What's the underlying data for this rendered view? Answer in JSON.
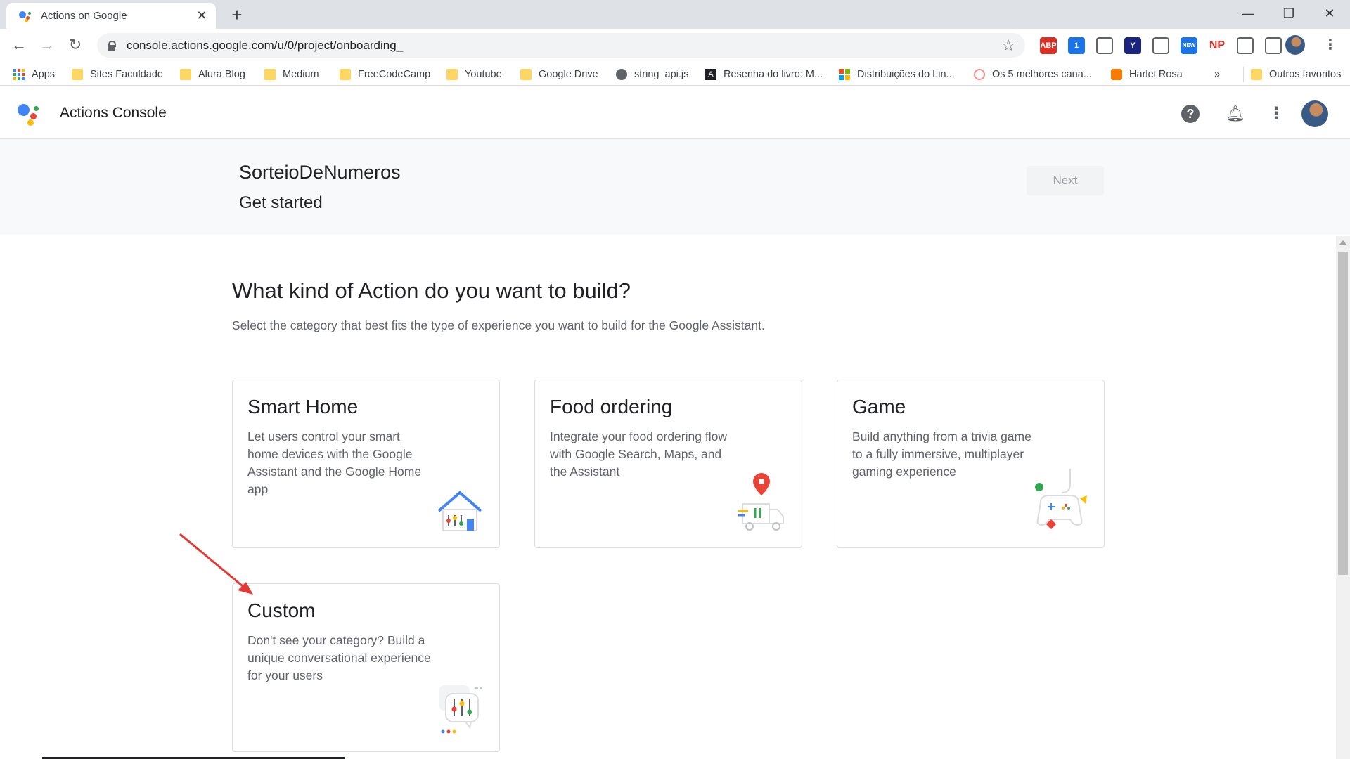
{
  "browser": {
    "tab_title": "Actions on Google",
    "url": "console.actions.google.com/u/0/project/onboarding_",
    "extensions": [
      {
        "name": "adblock-icon",
        "label": "ABP",
        "color": "#d93025"
      },
      {
        "name": "extension-badge-icon",
        "label": "1",
        "color": "#1a73e8"
      },
      {
        "name": "camera-icon",
        "label": "",
        "color": "#5f6368"
      },
      {
        "name": "yoast-icon",
        "label": "Y",
        "color": "#1a237e"
      },
      {
        "name": "screenshot-icon",
        "label": "",
        "color": "#5f6368"
      },
      {
        "name": "new-badge-icon",
        "label": "NEW",
        "color": "#1a73e8"
      },
      {
        "name": "np-icon",
        "label": "NP",
        "color": "#d93025"
      },
      {
        "name": "puzzle-icon",
        "label": "",
        "color": "#5f6368"
      },
      {
        "name": "reading-list-icon",
        "label": "",
        "color": "#5f6368"
      }
    ]
  },
  "bookmarks": [
    {
      "label": "Apps",
      "icon": "apps-grid-icon"
    },
    {
      "label": "Sites Faculdade",
      "icon": "folder-icon"
    },
    {
      "label": "Alura Blog",
      "icon": "folder-icon"
    },
    {
      "label": "Medium",
      "icon": "folder-icon"
    },
    {
      "label": "FreeCodeCamp",
      "icon": "folder-icon"
    },
    {
      "label": "Youtube",
      "icon": "folder-icon"
    },
    {
      "label": "Google Drive",
      "icon": "folder-icon"
    },
    {
      "label": "string_api.js",
      "icon": "globe-icon"
    },
    {
      "label": "Resenha do livro: M...",
      "icon": "angular-icon"
    },
    {
      "label": "Distribuições do Lin...",
      "icon": "microsoft-icon"
    },
    {
      "label": "Os 5 melhores cana...",
      "icon": "swirl-icon"
    },
    {
      "label": "Harlei Rosa",
      "icon": "blogger-icon"
    },
    {
      "label": "»",
      "icon": ""
    },
    {
      "label": "Outros favoritos",
      "icon": "folder-icon"
    }
  ],
  "app": {
    "title": "Actions Console"
  },
  "banner": {
    "project_name": "SorteioDeNumeros",
    "step": "Get started",
    "next_label": "Next"
  },
  "main": {
    "heading": "What kind of Action do you want to build?",
    "subheading": "Select the category that best fits the type of experience you want to build for the Google Assistant.",
    "cards": [
      {
        "title": "Smart Home",
        "description": "Let users control your smart home devices with the Google Assistant and the Google Home app"
      },
      {
        "title": "Food ordering",
        "description": "Integrate your food ordering flow with Google Search, Maps, and the Assistant"
      },
      {
        "title": "Game",
        "description": "Build anything from a trivia game to a fully immersive, multiplayer gaming experience"
      },
      {
        "title": "Custom",
        "description": "Don't see your category? Build a unique conversational experience for your users"
      }
    ]
  },
  "colors": {
    "google_blue": "#4285f4",
    "google_red": "#ea4335",
    "google_yellow": "#fbbc04",
    "google_green": "#34a853",
    "annotation_arrow": "#e53935"
  }
}
